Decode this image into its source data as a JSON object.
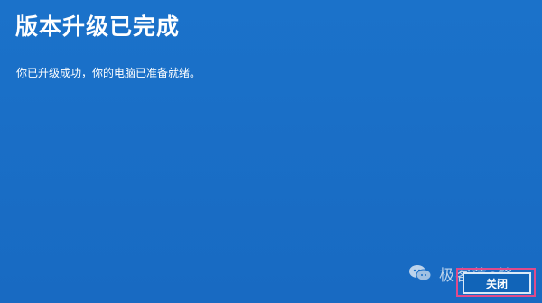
{
  "dialog": {
    "title": "版本升级已完成",
    "message": "你已升级成功，你的电脑已准备就绪。",
    "close_label": "关闭"
  },
  "watermark": {
    "text": "极客范e锋",
    "icon": "wechat-icon"
  },
  "colors": {
    "background": "#1a6fc7",
    "text": "#ffffff",
    "highlight_frame": "#e04a8a"
  }
}
